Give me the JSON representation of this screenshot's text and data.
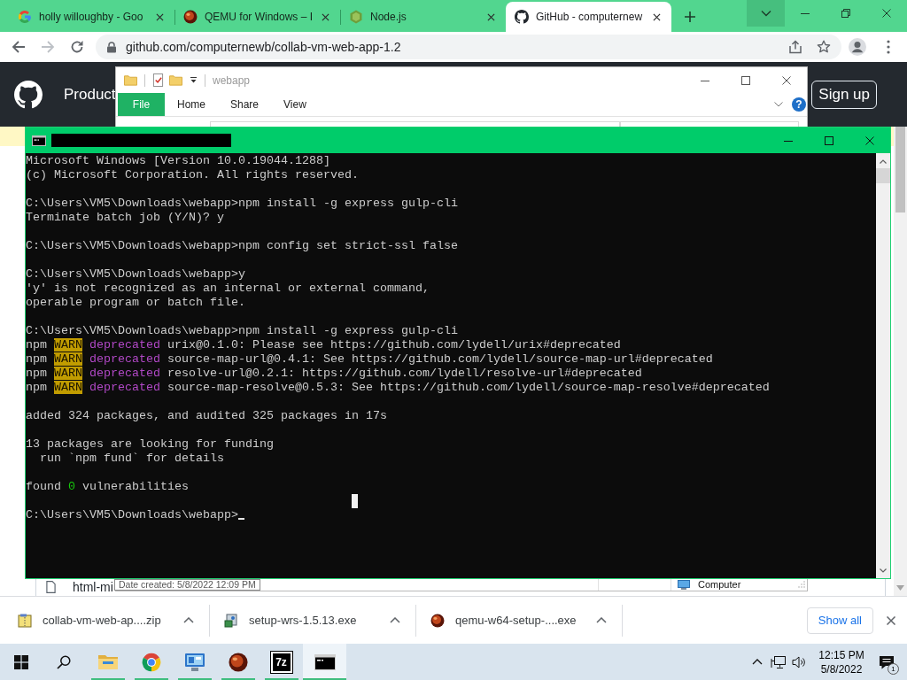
{
  "browser": {
    "tabs": [
      {
        "title": "holly willoughby - Goo",
        "kind": "g",
        "selected": false
      },
      {
        "title": "QEMU for Windows – I",
        "kind": "ball",
        "selected": false
      },
      {
        "title": "Node.js",
        "kind": "hexagon",
        "selected": false
      },
      {
        "title": "GitHub - computernew",
        "kind": "cat",
        "selected": true
      }
    ],
    "forward": {
      "disabled": true
    },
    "url": "github.com/computernewb/collab-vm-web-app-1.2"
  },
  "github_page": {
    "nav_item": "Product",
    "sign_up": "Sign up",
    "file_name": "html-mi"
  },
  "explorer": {
    "title": "webapp",
    "active": false,
    "ribbon_tabs": [
      {
        "label": "File",
        "kind": "menu"
      },
      {
        "label": "Home",
        "kind": "tab"
      },
      {
        "label": "Share",
        "kind": "tab"
      },
      {
        "label": "View",
        "kind": "tab"
      }
    ],
    "help": "?",
    "tooltip": "Date created: 5/8/2022 12:09 PM",
    "location": "Computer"
  },
  "terminal": {
    "active": true,
    "cursor": true,
    "blocks": [
      [
        [
          {
            "text": "Microsoft Windows [Version 10.0.19044.1288]",
            "kind": "text"
          }
        ],
        [
          {
            "text": "(c) Microsoft Corporation. All rights reserved.",
            "kind": "text"
          }
        ]
      ],
      [
        [
          {
            "text": "C:\\Users\\VM5\\Downloads\\webapp>npm install -g express gulp-cli",
            "kind": "text"
          }
        ],
        [
          {
            "text": "Terminate batch job (Y/N)? y",
            "kind": "text"
          }
        ]
      ],
      [
        [
          {
            "text": "C:\\Users\\VM5\\Downloads\\webapp>npm config set strict-ssl false",
            "kind": "text"
          }
        ]
      ],
      [
        [
          {
            "text": "C:\\Users\\VM5\\Downloads\\webapp>y",
            "kind": "text"
          }
        ],
        [
          {
            "text": "'y' is not recognized as an internal or external command,",
            "kind": "text"
          }
        ],
        [
          {
            "text": "operable program or batch file.",
            "kind": "text"
          }
        ]
      ],
      [
        [
          {
            "text": "C:\\Users\\VM5\\Downloads\\webapp>npm install -g express gulp-cli",
            "kind": "text"
          }
        ],
        [
          {
            "text": "npm ",
            "kind": "text"
          },
          {
            "text": "WARN",
            "kind": "warn"
          },
          {
            "text": " deprecated",
            "kind": "magenta"
          },
          {
            "text": " urix@0.1.0: Please see https://github.com/lydell/urix#deprecated",
            "kind": "text"
          }
        ],
        [
          {
            "text": "npm ",
            "kind": "text"
          },
          {
            "text": "WARN",
            "kind": "warn"
          },
          {
            "text": " deprecated",
            "kind": "magenta"
          },
          {
            "text": " source-map-url@0.4.1: See https://github.com/lydell/source-map-url#deprecated",
            "kind": "text"
          }
        ],
        [
          {
            "text": "npm ",
            "kind": "text"
          },
          {
            "text": "WARN",
            "kind": "warn"
          },
          {
            "text": " deprecated",
            "kind": "magenta"
          },
          {
            "text": " resolve-url@0.2.1: https://github.com/lydell/resolve-url#deprecated",
            "kind": "text"
          }
        ],
        [
          {
            "text": "npm ",
            "kind": "text"
          },
          {
            "text": "WARN",
            "kind": "warn"
          },
          {
            "text": " deprecated",
            "kind": "magenta"
          },
          {
            "text": " source-map-resolve@0.5.3: See https://github.com/lydell/source-map-resolve#deprecated",
            "kind": "text"
          }
        ]
      ],
      [
        [
          {
            "text": "added 324 packages, and audited 325 packages in 17s",
            "kind": "text"
          }
        ]
      ],
      [
        [
          {
            "text": "13 packages are looking for funding",
            "kind": "text"
          }
        ],
        [
          {
            "text": "  run `npm fund` for details",
            "kind": "text"
          }
        ]
      ],
      [
        [
          {
            "text": "found ",
            "kind": "text"
          },
          {
            "text": "0",
            "kind": "green"
          },
          {
            "text": " vulnerabilities",
            "kind": "text"
          }
        ]
      ],
      [
        [
          {
            "text": "C:\\Users\\VM5\\Downloads\\webapp>",
            "kind": "text"
          }
        ]
      ]
    ]
  },
  "downloads": {
    "items": [
      {
        "name": "collab-vm-web-ap....zip",
        "kind": "zip"
      },
      {
        "name": "setup-wrs-1.5.13.exe",
        "kind": "installer"
      },
      {
        "name": "qemu-w64-setup-....exe",
        "kind": "ball"
      }
    ],
    "show_all": "Show all"
  },
  "taskbar": {
    "apps": [
      {
        "kind": "folder",
        "running": true,
        "selected": false
      },
      {
        "kind": "chrome",
        "running": true,
        "selected": false
      },
      {
        "kind": "monitor",
        "running": true,
        "selected": false
      },
      {
        "kind": "ball",
        "running": true,
        "selected": false
      },
      {
        "kind": "archive",
        "label": "7z",
        "running": true,
        "selected": false
      },
      {
        "kind": "console",
        "running": true,
        "selected": true
      }
    ],
    "time": "12:15 PM",
    "date": "5/8/2022",
    "notifications": "1"
  }
}
